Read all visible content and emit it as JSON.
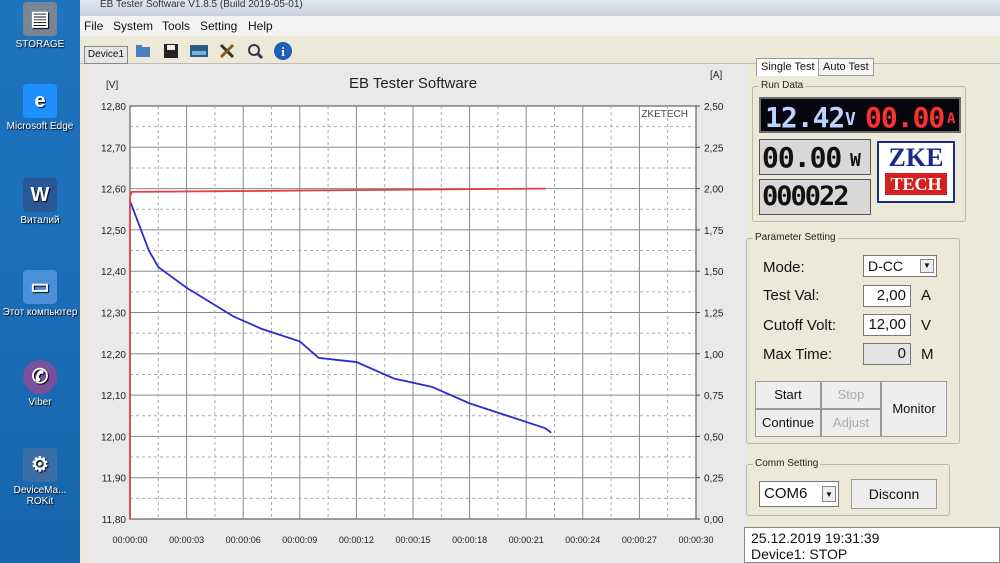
{
  "desktop": {
    "icons": [
      {
        "label": "STORAGE",
        "icon": "storage-icon"
      },
      {
        "label": "Microsoft Edge",
        "icon": "edge-icon"
      },
      {
        "label": "Виталий",
        "icon": "word-icon"
      },
      {
        "label": "Этот компьютер",
        "icon": "computer-icon"
      },
      {
        "label": "Viber",
        "icon": "viber-icon"
      },
      {
        "label": "DeviceMa... ROKit",
        "icon": "device-icon"
      }
    ]
  },
  "window": {
    "title": "EB Tester Software V1.8.5 (Build 2019-05-01)",
    "menu": [
      "File",
      "System",
      "Tools",
      "Setting",
      "Help"
    ],
    "device_button": "Device1",
    "toolbar_icons": [
      "open-icon",
      "save-icon",
      "image-icon",
      "tools-icon",
      "zoom-icon",
      "info-icon"
    ]
  },
  "chart_data": {
    "type": "line",
    "title": "EB Tester Software",
    "watermark": "ZKETECH",
    "left_unit": "[V]",
    "right_unit": "[A]",
    "y_left_ticks": [
      "12,80",
      "12,70",
      "12,60",
      "12,50",
      "12,40",
      "12,30",
      "12,20",
      "12,10",
      "12,00",
      "11,90",
      "11,80"
    ],
    "y_right_ticks": [
      "2,50",
      "2,25",
      "2,00",
      "1,75",
      "1,50",
      "1,25",
      "1,00",
      "0,75",
      "0,50",
      "0,25",
      "0,00"
    ],
    "x_ticks": [
      "00:00:00",
      "00:00:03",
      "00:00:06",
      "00:00:09",
      "00:00:12",
      "00:00:15",
      "00:00:18",
      "00:00:21",
      "00:00:24",
      "00:00:27",
      "00:00:30"
    ],
    "ylim_left": [
      11.8,
      12.8
    ],
    "ylim_right": [
      0,
      2.5
    ],
    "xlim": [
      0,
      30
    ],
    "grid": true,
    "series": [
      {
        "axis": "left",
        "color": "#2b2bd0",
        "x": [
          0,
          1,
          1.5,
          3,
          5.5,
          7,
          9,
          10,
          12,
          14,
          16,
          18,
          20,
          22,
          22.3
        ],
        "values": [
          12.57,
          12.45,
          12.41,
          12.36,
          12.29,
          12.26,
          12.23,
          12.19,
          12.18,
          12.14,
          12.12,
          12.08,
          12.05,
          12.02,
          12.01
        ]
      },
      {
        "axis": "right",
        "color": "#e04040",
        "x": [
          0,
          0,
          0.1,
          22
        ],
        "values": [
          0,
          1.95,
          1.98,
          2.0
        ]
      }
    ]
  },
  "tabs": {
    "single": "Single Test",
    "auto": "Auto Test"
  },
  "run_data": {
    "title": "Run Data",
    "voltage": "12.42",
    "voltage_unit": "V",
    "current": "00.00",
    "current_unit": "A",
    "power": "00.00",
    "power_unit": "W",
    "time": "000022",
    "logo_top": "ZKE",
    "logo_bottom": "TECH"
  },
  "params": {
    "title": "Parameter Setting",
    "mode_label": "Mode:",
    "mode_value": "D-CC",
    "test_val_label": "Test Val:",
    "test_val": "2,00",
    "test_val_unit": "A",
    "cutoff_label": "Cutoff Volt:",
    "cutoff_val": "12,00",
    "cutoff_unit": "V",
    "max_time_label": "Max Time:",
    "max_time_val": "0",
    "max_time_unit": "M",
    "btn_start": "Start",
    "btn_stop": "Stop",
    "btn_continue": "Continue",
    "btn_adjust": "Adjust",
    "btn_monitor": "Monitor"
  },
  "comm": {
    "title": "Comm Setting",
    "port": "COM6",
    "disconn": "Disconn"
  },
  "status": {
    "datetime": "25.12.2019 19:31:39",
    "device": "Device1: STOP"
  }
}
